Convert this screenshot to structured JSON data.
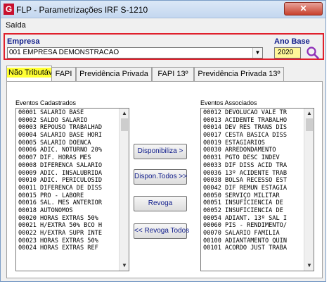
{
  "window": {
    "title": "FLP - Parametrizações IRF S-1210",
    "close_label": "✕"
  },
  "menu": {
    "items": [
      {
        "label": "Saída"
      }
    ]
  },
  "empresa": {
    "label": "Empresa",
    "value": "001 EMPRESA DEMONSTRACAO"
  },
  "ano_base": {
    "label": "Ano Base",
    "value": "2020"
  },
  "icons": {
    "app": "flp-app-icon",
    "search": "search-icon",
    "dropdown": "chevron-down-icon"
  },
  "colors": {
    "highlight_border": "#e0202c",
    "label_blue": "#0e1b8a",
    "year_bg": "#fff799",
    "active_tab_highlight": "#ffff33"
  },
  "tabs": [
    {
      "label": "Não Tributáveis",
      "active": true
    },
    {
      "label": "FAPI",
      "active": false
    },
    {
      "label": "Previdência Privada",
      "active": false
    },
    {
      "label": "FAPI 13º",
      "active": false
    },
    {
      "label": "Previdência Privada 13º",
      "active": false
    }
  ],
  "eventos_cadastrados": {
    "label": "Eventos Cadastrados",
    "items": [
      "00001 SALARIO BASE",
      "00002 SALDO SALARIO",
      "00003 REPOUSO TRABALHAD",
      "00004 SALARIO BASE HORI",
      "00005 SALARIO DOENCA",
      "00006 ADIC. NOTURNO 20%",
      "00007 DIF. HORAS MES",
      "00008 DIFERENCA SALARIO",
      "00009 ADIC. INSALUBRIDA",
      "00010 ADIC. PERICULOSID",
      "00011 DIFERENCA DE DISS",
      "00015 PRO - LABORE",
      "00016 SAL. MES ANTERIOR",
      "00018 AUTONOMOS",
      "00020 HORAS EXTRAS 50%",
      "00021 H/EXTRA 50% BCO H",
      "00022 H/EXTRA SUPR INTE",
      "00023 HORAS EXTRAS 50%",
      "00024 HORAS EXTRAS REF"
    ]
  },
  "eventos_associados": {
    "label": "Eventos Associados",
    "items": [
      "00012 DEVOLUCAO VALE TR",
      "00013 ACIDENTE TRABALHO",
      "00014 DEV RES TRANS DIS",
      "00017 CESTA BASICA DISS",
      "00019 ESTAGIARIOS",
      "00030 ARREDONDAMENTO",
      "00031 PGTO DESC INDEV",
      "00033 DIF DISS ACID TRA",
      "00036 13º ACIDENTE TRAB",
      "00038 BOLSA RECESSO EST",
      "00042 DIF REMUN ESTAGIA",
      "00050 SERVIÇO MILITAR",
      "00051 INSUFICIENCIA DE",
      "00052 INSUFICIENCIA DE",
      "00054 ADIANT. 13º SAL I",
      "00060 PIS - RENDIMENTO/",
      "00070 SALARIO FAMILIA",
      "00100 ADIANTAMENTO QUIN",
      "00101 ACORDO JUST TRABA"
    ]
  },
  "buttons": {
    "disponibiliza": "Disponibiliza >",
    "dispon_todos": "Dispon.Todos >>",
    "revoga": "Revoga",
    "revoga_todos": "<< Revoga Todos"
  }
}
